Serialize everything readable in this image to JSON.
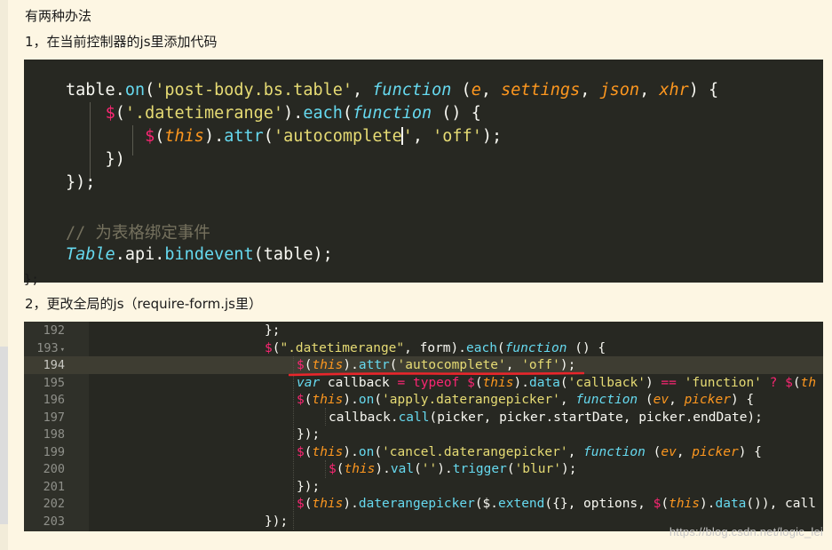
{
  "article": {
    "intro": "有两种办法",
    "step1": "1，在当前控制器的js里添加代码",
    "step2": "2，更改全局的js（require-form.js里）"
  },
  "code_block_1": {
    "lines": [
      {
        "segments": [
          [
            "table.",
            ""
          ],
          [
            "on",
            "kw-fn"
          ],
          [
            "(",
            ""
          ],
          [
            "'post-body.bs.table'",
            "str"
          ],
          [
            ", ",
            ""
          ],
          [
            "function",
            "ital-fn"
          ],
          [
            " (",
            ""
          ],
          [
            "e",
            "param"
          ],
          [
            ", ",
            ""
          ],
          [
            "settings",
            "param"
          ],
          [
            ", ",
            ""
          ],
          [
            "json",
            "param"
          ],
          [
            ", ",
            ""
          ],
          [
            "xhr",
            "param"
          ],
          [
            ") {",
            ""
          ]
        ]
      },
      {
        "segments": [
          [
            "    ",
            ""
          ],
          [
            "$",
            "dollar"
          ],
          [
            "(",
            ""
          ],
          [
            "'.datetimerange'",
            "str"
          ],
          [
            ").",
            ""
          ],
          [
            "each",
            "kw-fn"
          ],
          [
            "(",
            ""
          ],
          [
            "function",
            "ital-fn"
          ],
          [
            " () {",
            ""
          ]
        ]
      },
      {
        "segments": [
          [
            "        ",
            ""
          ],
          [
            "$",
            "dollar"
          ],
          [
            "(",
            ""
          ],
          [
            "this",
            "this"
          ],
          [
            ").",
            ""
          ],
          [
            "attr",
            "kw-fn"
          ],
          [
            "(",
            ""
          ],
          [
            "'autocomplete",
            "str"
          ],
          [
            "|",
            "caret"
          ],
          [
            "'",
            "str"
          ],
          [
            ", ",
            ""
          ],
          [
            "'off'",
            "str"
          ],
          [
            ");",
            ""
          ]
        ]
      },
      {
        "segments": [
          [
            "    })",
            ""
          ]
        ]
      },
      {
        "segments": [
          [
            "});",
            ""
          ]
        ]
      },
      {
        "segments": [
          [
            "",
            ""
          ]
        ]
      },
      {
        "segments": [
          [
            "// 为表格绑定事件",
            "comment"
          ]
        ]
      },
      {
        "segments": [
          [
            "Table",
            "classname"
          ],
          [
            ".api.",
            ""
          ],
          [
            "bindevent",
            "kw-fn"
          ],
          [
            "(table);",
            ""
          ]
        ]
      }
    ],
    "trailing": "};"
  },
  "code_block_2": {
    "line_numbers": [
      "192",
      "193",
      "194",
      "195",
      "196",
      "197",
      "198",
      "199",
      "200",
      "201",
      "202",
      "203"
    ],
    "fold_marker": "▾",
    "active_line": "194",
    "lines": [
      {
        "segments": [
          [
            "};",
            ""
          ]
        ],
        "indent": 0
      },
      {
        "segments": [
          [
            "$",
            "dollar"
          ],
          [
            "(",
            ""
          ],
          [
            "\".datetimerange\"",
            "str"
          ],
          [
            ", form).",
            ""
          ],
          [
            "each",
            "kw-fn"
          ],
          [
            "(",
            ""
          ],
          [
            "function",
            "ital-fn"
          ],
          [
            " () {",
            ""
          ]
        ],
        "indent": 0
      },
      {
        "segments": [
          [
            "$",
            "dollar"
          ],
          [
            "(",
            ""
          ],
          [
            "this",
            "this"
          ],
          [
            ").",
            ""
          ],
          [
            "attr",
            "kw-fn"
          ],
          [
            "(",
            ""
          ],
          [
            "'autocomplete'",
            "str"
          ],
          [
            ", ",
            ""
          ],
          [
            "'off'",
            "str"
          ],
          [
            ");",
            ""
          ]
        ],
        "indent": 1
      },
      {
        "segments": [
          [
            "var",
            "ital-fn"
          ],
          [
            " callback ",
            ""
          ],
          [
            "=",
            "dollar"
          ],
          [
            " ",
            ""
          ],
          [
            "typeof",
            "dollar"
          ],
          [
            " ",
            ""
          ],
          [
            "$",
            "dollar"
          ],
          [
            "(",
            ""
          ],
          [
            "this",
            "this"
          ],
          [
            ").",
            ""
          ],
          [
            "data",
            "kw-fn"
          ],
          [
            "(",
            ""
          ],
          [
            "'callback'",
            "str"
          ],
          [
            ") ",
            ""
          ],
          [
            "==",
            "dollar"
          ],
          [
            " ",
            ""
          ],
          [
            "'function'",
            "str"
          ],
          [
            " ",
            ""
          ],
          [
            "?",
            "dollar"
          ],
          [
            " ",
            ""
          ],
          [
            "$",
            "dollar"
          ],
          [
            "(",
            ""
          ],
          [
            "th",
            "this"
          ]
        ],
        "indent": 1
      },
      {
        "segments": [
          [
            "$",
            "dollar"
          ],
          [
            "(",
            ""
          ],
          [
            "this",
            "this"
          ],
          [
            ").",
            ""
          ],
          [
            "on",
            "kw-fn"
          ],
          [
            "(",
            ""
          ],
          [
            "'apply.daterangepicker'",
            "str"
          ],
          [
            ", ",
            ""
          ],
          [
            "function",
            "ital-fn"
          ],
          [
            " (",
            ""
          ],
          [
            "ev",
            "param"
          ],
          [
            ", ",
            ""
          ],
          [
            "picker",
            "param"
          ],
          [
            ") {",
            ""
          ]
        ],
        "indent": 1
      },
      {
        "segments": [
          [
            "callback.",
            ""
          ],
          [
            "call",
            "kw-fn"
          ],
          [
            "(picker, picker.startDate, picker.endDate);",
            ""
          ]
        ],
        "indent": 2
      },
      {
        "segments": [
          [
            "});",
            ""
          ]
        ],
        "indent": 1
      },
      {
        "segments": [
          [
            "$",
            "dollar"
          ],
          [
            "(",
            ""
          ],
          [
            "this",
            "this"
          ],
          [
            ").",
            ""
          ],
          [
            "on",
            "kw-fn"
          ],
          [
            "(",
            ""
          ],
          [
            "'cancel.daterangepicker'",
            "str"
          ],
          [
            ", ",
            ""
          ],
          [
            "function",
            "ital-fn"
          ],
          [
            " (",
            ""
          ],
          [
            "ev",
            "param"
          ],
          [
            ", ",
            ""
          ],
          [
            "picker",
            "param"
          ],
          [
            ") {",
            ""
          ]
        ],
        "indent": 1
      },
      {
        "segments": [
          [
            "$",
            "dollar"
          ],
          [
            "(",
            ""
          ],
          [
            "this",
            "this"
          ],
          [
            ").",
            ""
          ],
          [
            "val",
            "kw-fn"
          ],
          [
            "(",
            ""
          ],
          [
            "''",
            "str"
          ],
          [
            ").",
            ""
          ],
          [
            "trigger",
            "kw-fn"
          ],
          [
            "(",
            ""
          ],
          [
            "'blur'",
            "str"
          ],
          [
            ");",
            ""
          ]
        ],
        "indent": 2
      },
      {
        "segments": [
          [
            "});",
            ""
          ]
        ],
        "indent": 1
      },
      {
        "segments": [
          [
            "$",
            "dollar"
          ],
          [
            "(",
            ""
          ],
          [
            "this",
            "this"
          ],
          [
            ").",
            ""
          ],
          [
            "daterangepicker",
            "kw-fn"
          ],
          [
            "($.",
            ""
          ],
          [
            "extend",
            "kw-fn"
          ],
          [
            "({}, options, ",
            ""
          ],
          [
            "$",
            "dollar"
          ],
          [
            "(",
            ""
          ],
          [
            "this",
            "this"
          ],
          [
            ").",
            ""
          ],
          [
            "data",
            "kw-fn"
          ],
          [
            "()), call",
            ""
          ]
        ],
        "indent": 1
      },
      {
        "segments": [
          [
            "});",
            ""
          ]
        ],
        "indent": 0
      }
    ]
  },
  "watermark": "https://blog.csdn.net/logic_lei",
  "colors": {
    "page_bg": "#fdf6e3",
    "code_bg": "#272822",
    "string": "#e6db74",
    "keyword": "#66d9ef",
    "accent_red": "#f92672",
    "param": "#fd971f",
    "comment": "#75715e",
    "underline": "#e8262b"
  }
}
